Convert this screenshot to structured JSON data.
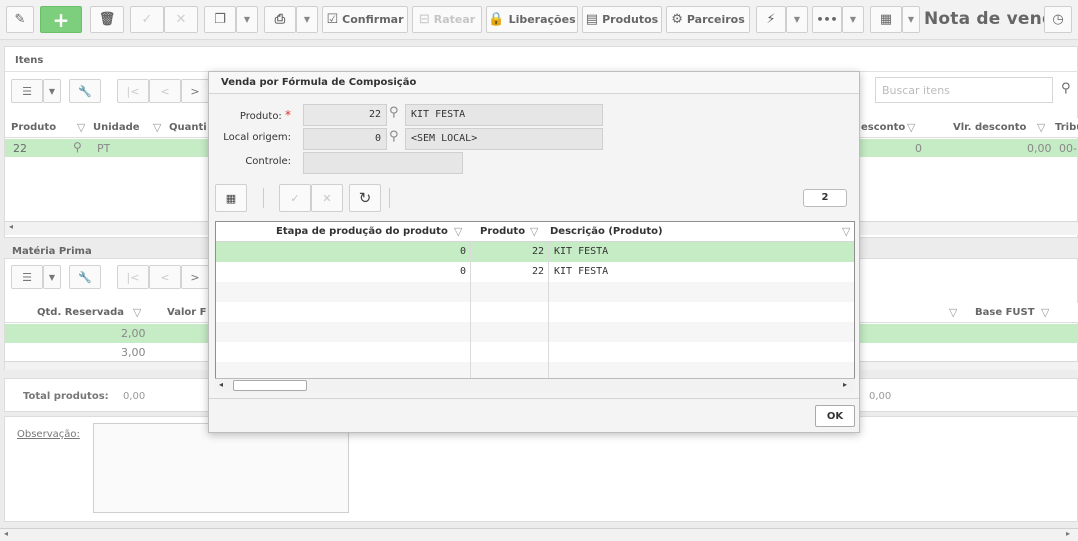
{
  "toolbar": {
    "confirm_label": "Confirmar",
    "rateio_label": "Ratear",
    "liberacoes_label": "Liberações",
    "produtos_label": "Produtos",
    "parceiros_label": "Parceiros",
    "more_label": "•••",
    "page_title": "Nota de venda"
  },
  "itens": {
    "section_label": "Itens",
    "search_placeholder": "Buscar itens",
    "columns": [
      "Produto",
      "Unidade",
      "Quanti",
      "esconto",
      "Vlr. desconto",
      "Tribu"
    ],
    "row": {
      "produto": "22",
      "unidade": "PT",
      "esconto": "0",
      "vlr_desconto": "0,00",
      "tribu": "00-"
    }
  },
  "materia": {
    "section_label": "Matéria Prima",
    "columns": [
      "Qtd. Reservada",
      "Valor F",
      "Base FUST"
    ],
    "rows": [
      "2,00",
      "3,00"
    ]
  },
  "totals": {
    "label": "Total produtos:",
    "value": "0,00",
    "right_value": "0,00"
  },
  "observacao_label": "Observação:",
  "modal": {
    "title": "Venda por Fórmula de Composição",
    "produto_label": "Produto:",
    "produto_code": "22",
    "produto_desc": "KIT FESTA",
    "local_label": "Local origem:",
    "local_code": "0",
    "local_desc": "<SEM LOCAL>",
    "controle_label": "Controle:",
    "count_badge": "2",
    "columns": [
      "Etapa de produção do produto",
      "Produto",
      "Descrição (Produto)"
    ],
    "rows": [
      {
        "etapa": "0",
        "produto": "22",
        "descricao": "KIT FESTA"
      },
      {
        "etapa": "0",
        "produto": "22",
        "descricao": "KIT FESTA"
      }
    ],
    "ok_label": "OK"
  },
  "colors": {
    "selected_row": "#c6ecc6",
    "add_button": "#7dcf7d",
    "required": "#dd3333"
  }
}
